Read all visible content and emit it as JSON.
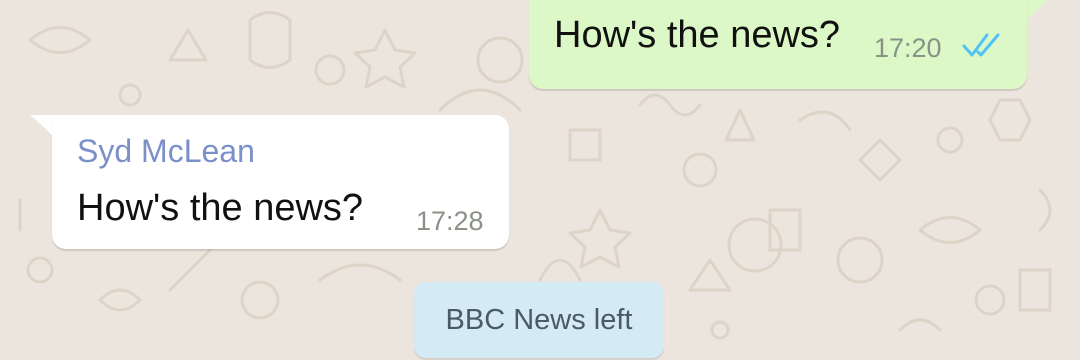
{
  "messages": [
    {
      "direction": "outgoing",
      "text": "How's the news?",
      "time": "17:20",
      "status": "read-double-tick-icon"
    },
    {
      "direction": "incoming",
      "sender": "Syd McLean",
      "text": "How's the news?",
      "time": "17:28"
    }
  ],
  "system_message": {
    "text": "BBC News left"
  },
  "colors": {
    "wallpaper": "#ece5dd",
    "outgoing_bubble": "#dcf8c6",
    "incoming_bubble": "#ffffff",
    "system_bubble": "#d4eaf4",
    "sender_name": "#7b8fc9",
    "read_ticks": "#4fc3f7"
  }
}
